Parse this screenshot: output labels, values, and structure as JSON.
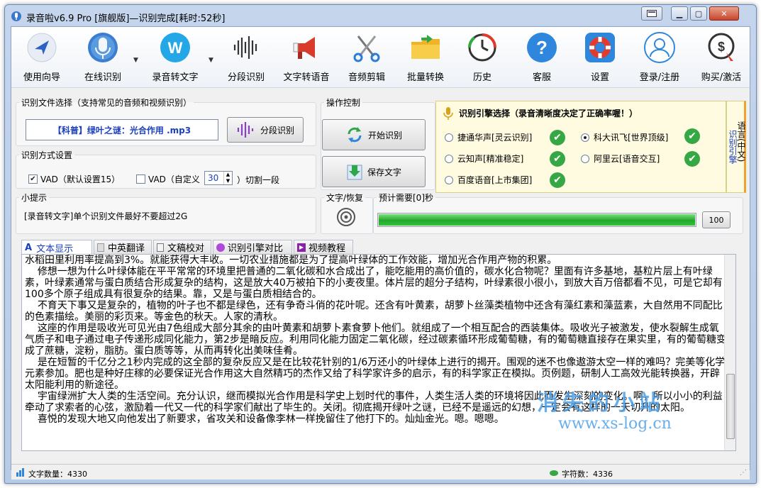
{
  "window": {
    "title": "录音啦v6.9 Pro [旗舰版]—识别完成[耗时:52秒]"
  },
  "toolbar": {
    "items": [
      {
        "label": "使用向导",
        "icon": "guide-arrow-icon"
      },
      {
        "label": "在线识别",
        "icon": "microphone-icon"
      },
      {
        "label": "录音转文字",
        "icon": "w-badge-icon"
      },
      {
        "label": "分段识别",
        "icon": "waveform-icon"
      },
      {
        "label": "文字转语音",
        "icon": "megaphone-icon"
      },
      {
        "label": "音频剪辑",
        "icon": "scissors-icon"
      },
      {
        "label": "批量转换",
        "icon": "folder-icon"
      },
      {
        "label": "历史",
        "icon": "history-clock-icon"
      },
      {
        "label": "客服",
        "icon": "help-icon"
      },
      {
        "label": "设置",
        "icon": "lifebuoy-icon"
      },
      {
        "label": "登录/注册",
        "icon": "user-icon"
      },
      {
        "label": "购买/激活",
        "icon": "purchase-icon"
      }
    ]
  },
  "file_select": {
    "legend": "识别文件选择（支持常见的音频和视频识别）",
    "filename": "【科普】绿叶之谜：光合作用 .mp3",
    "segment_button": "分段识别"
  },
  "mode": {
    "legend": "识别方式设置",
    "vad_default_label": "VAD（默认设置15）",
    "vad_default_checked": true,
    "vad_custom_label": "VAD（自定义",
    "vad_custom_checked": false,
    "vad_custom_value": "30",
    "vad_custom_suffix": "）切割一段"
  },
  "tips": {
    "legend": "小提示",
    "text": "[录音转文字]单个识别文件最好不要超过2G"
  },
  "operation": {
    "legend": "操作控制",
    "start_button": "开始识别",
    "save_button": "保存文字"
  },
  "recover": {
    "legend": "文字/恢复"
  },
  "engine": {
    "legend": "识别引擎选择（录音清晰度决定了正确率喔！）",
    "options": [
      {
        "label": "捷通华声[灵云识别]",
        "selected": false
      },
      {
        "label": "科大讯飞[世界顶级]",
        "selected": true
      },
      {
        "label": "云知声[精准稳定]",
        "selected": false
      },
      {
        "label": "阿里云[语音交互]",
        "selected": false
      },
      {
        "label": "百度语音[上市集团]",
        "selected": false
      }
    ],
    "side_tab_label": "语言(中文)",
    "side_tab_label2": "识别引擎"
  },
  "progress": {
    "legend": "预计需要[0]秒",
    "value": 100,
    "button": "100"
  },
  "tabs": [
    {
      "label": "文本显示",
      "active": true
    },
    {
      "label": "中英翻译",
      "active": false
    },
    {
      "label": "文稿校对",
      "active": false
    },
    {
      "label": "识别引擎对比",
      "active": false
    },
    {
      "label": "视频教程",
      "active": false
    }
  ],
  "content": {
    "text": "水稻田里利用率提高到3%。就能获得大丰收。一切农业措施都是为了提高叶绿体的工作效能，增加光合作用产物的积累。\n    修想一想为什么叶绿体能在平平常常的环境里把普通的二氧化碳和水合成出了，能吃能用的高价值的，碳水化合物呢？里面有许多基地，基粒片层上有叶绿素，叶绿素通常与蛋白质结合形成复杂的结构，这是放大40万被拍下的小麦夜里。体片层的超分子结构，叶绿素很小很小，到放大百万倍都看不见，可是它却有100多个原子组成具有很复杂的结果。靠，又是与蛋白质相结合的。\n    不育天下事又是复杂的，植物的叶子也不都是绿色，还有争奇斗俏的花叶呢。还含有叶黄素，胡萝卜丝藻类植物中还含有藻红素和藻蓝素，大自然用不同配比的色素描绘。美丽的彩页来。等金色的秋天。人家的清秋。\n    这座的作用是吸收光可见光由7色组成大部分其余的由叶黄素和胡萝卜素食萝卜他们。就组成了一个相互配合的西装集体。吸收光子被激发，使水裂解生成氧气质子和电子通过电子传递形成同化能力，第2步是暗反应。利用同化能力固定二氧化碳，经过碳素循环形成葡萄糖，有的葡萄糖直接存在果实里，有的葡萄糖变成了蔗糖，淀粉，脂肪。蛋白质等等，从而再转化出美味佳肴。\n    是在短暂的千亿分之1秒内完成的这全部的复杂反应又是在比较花针别的1/6万还小的叶绿体上进行的揭开。围观的迷不也像遨游太空一样的难吗？完美等化学元素参加。肥也是种好庄稼的必要保证光合作用这大自然精巧的杰作又给了科学家许多的启示，有的科学家正在模拟。页例题，研制人工高效光能转换器，开辟太阳能利用的新途径。\n    宇宙绿洲扩大人类的生活空间。充分认识，继而模拟光合作用是科学史上划时代的事件，人类生活人类的环境将因此而发生深刻的变化。啊，所以小小的利益牵动了求索者的心弦，激励着一代又一代的科学家们献出了毕生的。关闭。彻底揭开绿叶之谜，已经不是遥远的幻想，一定会有这样的一天切升的太阳。\n    喜悦的发现大地又向他发出了新要求，省攻关和设备像李林一样挽留住了他打下的。灿灿金光。嗯。嗯嗯。"
  },
  "watermark": {
    "line1": "消失的小站",
    "line2": "www.xs-log.cn"
  },
  "status": {
    "char_count_label": "文字数量：4330",
    "byte_count_label": "字符数：4336"
  },
  "colors": {
    "accent_blue": "#1a3fbf",
    "progress_green": "#22b02a",
    "ok_green": "#35a845",
    "engine_highlight": "#fff8c4",
    "watermark": "#4ea0e8"
  }
}
